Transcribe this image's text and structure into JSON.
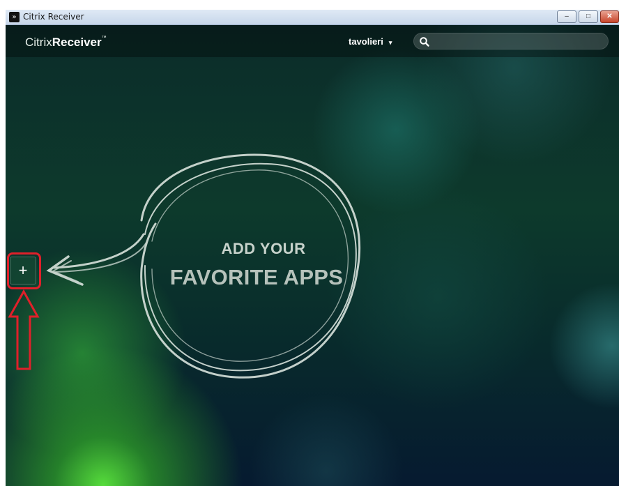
{
  "window": {
    "title": "Citrix Receiver",
    "app_icon_glyph": "»",
    "controls": {
      "minimize": "–",
      "maximize": "□",
      "close": "✕"
    }
  },
  "header": {
    "logo_light": "Citrix",
    "logo_bold": "Receiver",
    "logo_tm": "™",
    "username": "tavolieri",
    "user_caret": "▾",
    "search": {
      "value": "",
      "placeholder": "",
      "icon": "search-icon"
    }
  },
  "main": {
    "empty_state_line1": "ADD YOUR",
    "empty_state_line2": "FAVORITE APPS",
    "add_button_label": "+"
  },
  "annotation": {
    "highlight_color": "#e0202a"
  },
  "colors": {
    "accent_green": "#3ed640",
    "header_bg": "#0a1f1c"
  }
}
